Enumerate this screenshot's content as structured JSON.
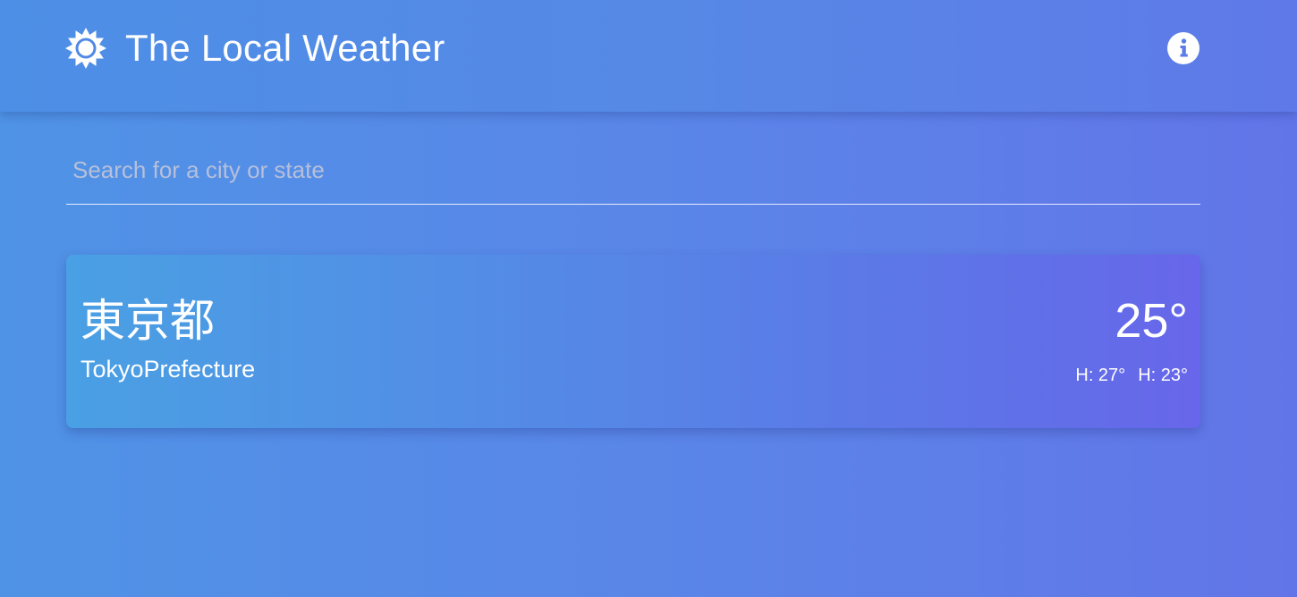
{
  "header": {
    "title": "The Local Weather",
    "logo_icon": "sun-icon",
    "info_icon": "info-icon"
  },
  "search": {
    "placeholder": "Search for a city or state",
    "value": ""
  },
  "cards": [
    {
      "city_native": "東京都",
      "city_name": "TokyoPrefecture",
      "temperature": "25°",
      "high": "H: 27°",
      "low": "H: 23°"
    }
  ],
  "colors": {
    "background_start": "#4f93e6",
    "background_end": "#6275e8",
    "card_start": "#4aa0e4",
    "card_end": "#6866ea",
    "info_icon_fg": "#5a7be8"
  }
}
